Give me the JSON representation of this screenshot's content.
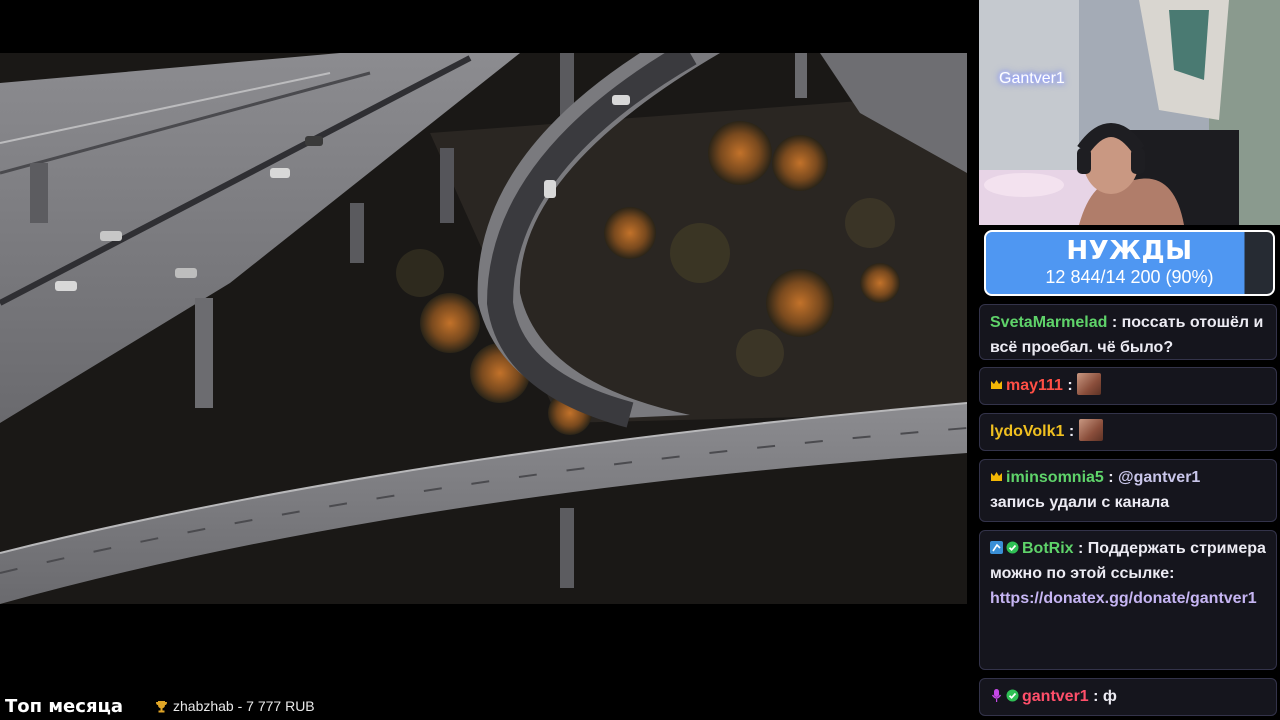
{
  "webcam": {
    "name_overlay": "Gantver1"
  },
  "goal": {
    "title": "НУЖДЫ",
    "progress_text": "12 844/14 200 (90%)",
    "progress_fraction": 0.9,
    "fill_color": "#4f97f2"
  },
  "chat": {
    "messages": [
      {
        "nick": "SvetaMarmelad",
        "nick_color": "#5fd36a",
        "separator": " : ",
        "text": "поссать отошёл и всё проебал. чё было?"
      },
      {
        "nick": "may111",
        "nick_color": "#ff4f45",
        "separator": " : ",
        "badge": "crown-icon",
        "emote": "emote"
      },
      {
        "nick": "lydoVolk1",
        "nick_color": "#f0c020",
        "separator": " : ",
        "emote": "emote"
      },
      {
        "nick": "iminsomnia5",
        "nick_color": "#5fd36a",
        "separator": " : ",
        "badge": "crown-icon",
        "mention": "@gantver1",
        "text": "запись удали с канала"
      },
      {
        "nick": "BotRix",
        "nick_color": "#5fd36a",
        "separator": " : ",
        "badges": [
          "bot-icon",
          "verified-icon"
        ],
        "text": "Поддержать стримера можно по этой ссылке:",
        "link": "https://donatex.gg/donate/gantver1"
      },
      {
        "nick": "gantver1",
        "nick_color": "#ff4f6a",
        "separator": " : ",
        "badges": [
          "mic-icon",
          "verified-icon"
        ],
        "text": "ф"
      }
    ]
  },
  "bottom_bar": {
    "label": "Топ месяца",
    "donor": "zhabzhab - 7 777 RUB",
    "icon": "trophy-icon"
  }
}
